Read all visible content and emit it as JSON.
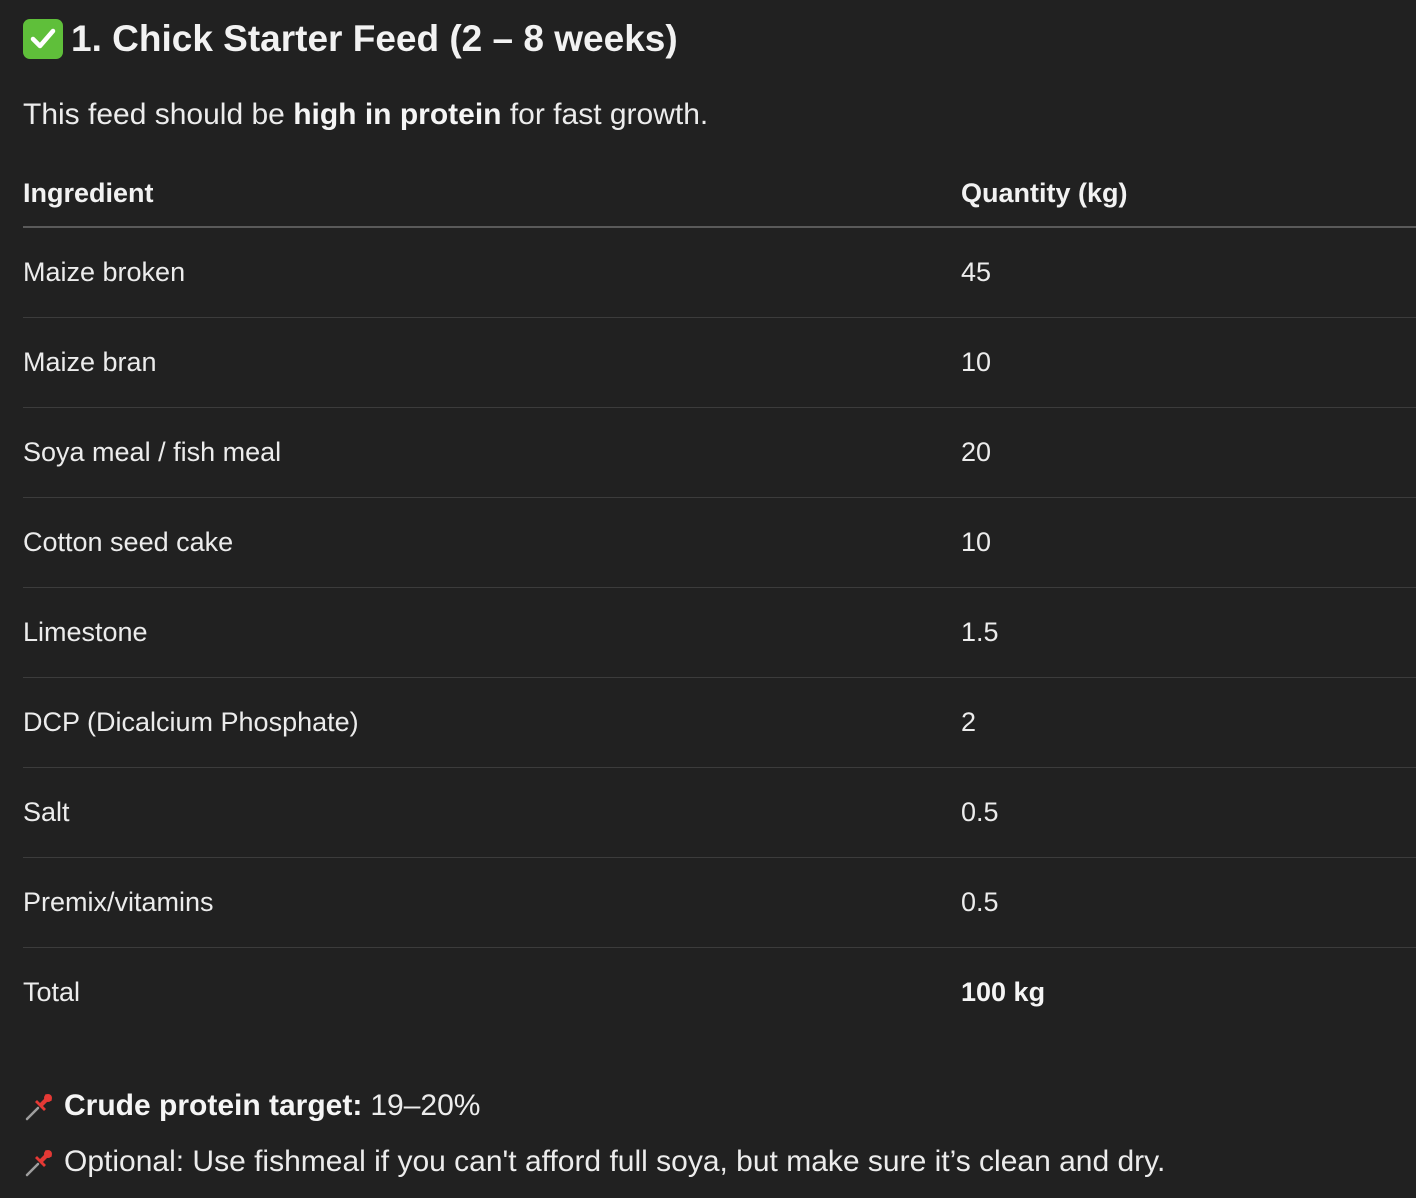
{
  "heading": {
    "icon": "check-mark-button-icon",
    "text": "1. Chick Starter Feed (2 – 8 weeks)"
  },
  "intro": {
    "before": "This feed should be ",
    "bold": "high in protein",
    "after": " for fast growth."
  },
  "table": {
    "headers": [
      "Ingredient",
      "Quantity (kg)"
    ],
    "rows": [
      {
        "ingredient": "Maize broken",
        "quantity": "45"
      },
      {
        "ingredient": "Maize bran",
        "quantity": "10"
      },
      {
        "ingredient": "Soya meal / fish meal",
        "quantity": "20"
      },
      {
        "ingredient": "Cotton seed cake",
        "quantity": "10"
      },
      {
        "ingredient": "Limestone",
        "quantity": "1.5"
      },
      {
        "ingredient": "DCP (Dicalcium Phosphate)",
        "quantity": "2"
      },
      {
        "ingredient": "Salt",
        "quantity": "0.5"
      },
      {
        "ingredient": "Premix/vitamins",
        "quantity": "0.5"
      },
      {
        "ingredient": "Total",
        "quantity": "100 kg"
      }
    ]
  },
  "notes": [
    {
      "icon": "pushpin-icon",
      "bold": "Crude protein target:",
      "text": "19–20%"
    },
    {
      "icon": "pushpin-icon",
      "bold": "",
      "text": "Optional: Use fishmeal if you can't afford full soya, but make sure it’s clean and dry."
    }
  ],
  "colors": {
    "background": "#212121",
    "text": "#ececec",
    "check_icon": "#5fbf3a",
    "pin_icon": "#e53935"
  }
}
